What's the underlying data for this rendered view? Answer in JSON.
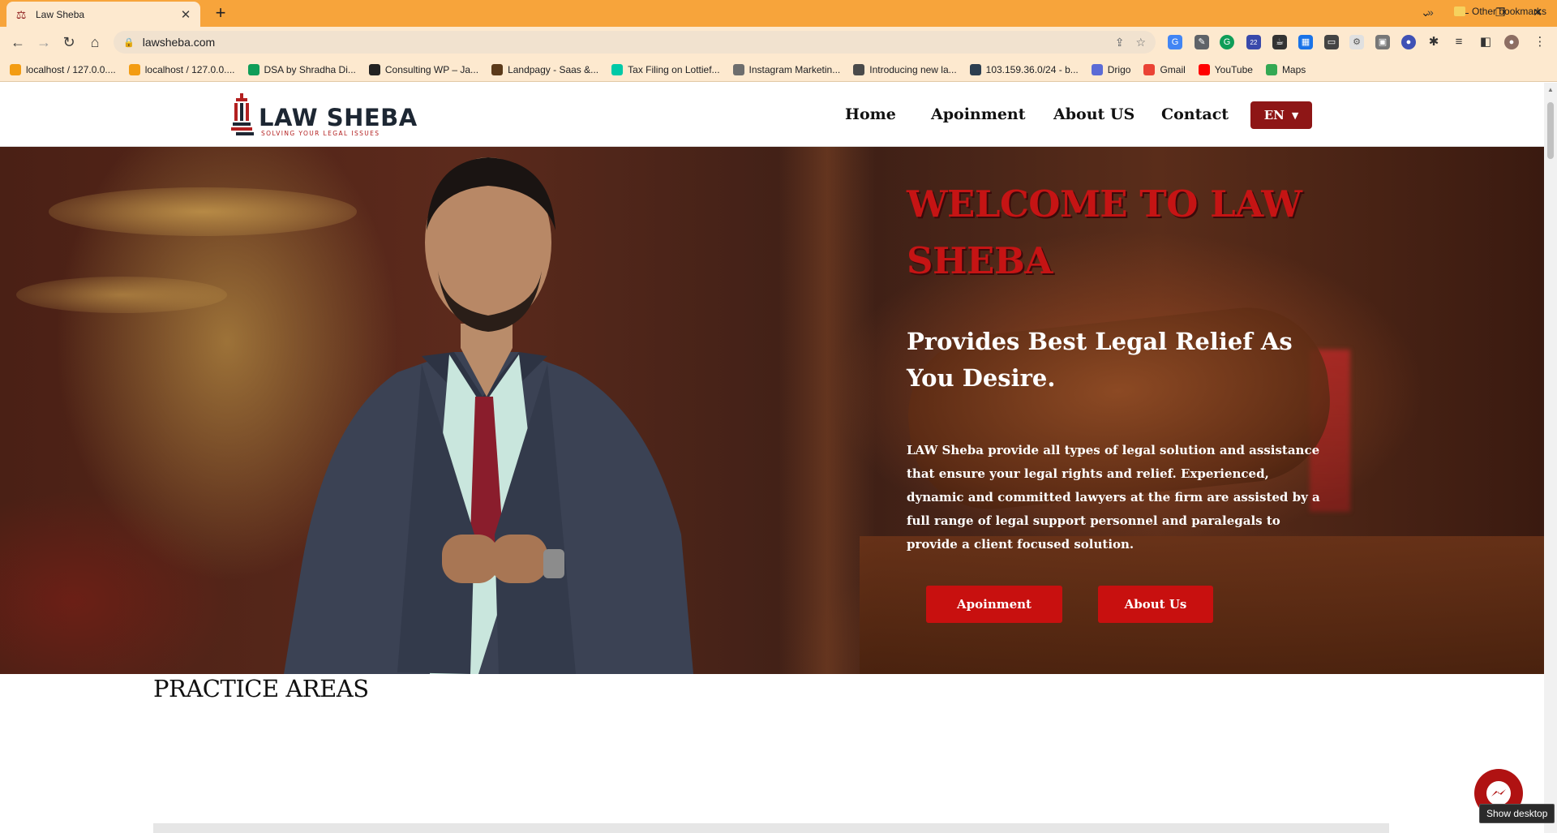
{
  "browser": {
    "tab_title": "Law Sheba",
    "url": "lawsheba.com",
    "bookmarks": [
      {
        "label": "localhost / 127.0.0....",
        "icon": "pma-icon",
        "color": "#f39c12"
      },
      {
        "label": "localhost / 127.0.0....",
        "icon": "pma-icon",
        "color": "#f39c12"
      },
      {
        "label": "DSA by Shradha Di...",
        "icon": "sheets-icon",
        "color": "#0f9d58"
      },
      {
        "label": "Consulting WP – Ja...",
        "icon": "c-icon",
        "color": "#222222"
      },
      {
        "label": "Landpagy - Saas &...",
        "icon": "landpagy-icon",
        "color": "#5b3a1a"
      },
      {
        "label": "Tax Filing on Lottief...",
        "icon": "lottie-icon",
        "color": "#00c9a7"
      },
      {
        "label": "Instagram Marketin...",
        "icon": "instagram-icon",
        "color": "#6d6d6d"
      },
      {
        "label": "Introducing new la...",
        "icon": "wordpress-icon",
        "color": "#4a4a4a"
      },
      {
        "label": "103.159.36.0/24 - b...",
        "icon": "network-icon",
        "color": "#2c3e50"
      },
      {
        "label": "Drigo",
        "icon": "drigo-icon",
        "color": "#5b6bd6"
      },
      {
        "label": "Gmail",
        "icon": "gmail-icon",
        "color": "#ea4335"
      },
      {
        "label": "YouTube",
        "icon": "youtube-icon",
        "color": "#ff0000"
      },
      {
        "label": "Maps",
        "icon": "maps-icon",
        "color": "#34a853"
      }
    ],
    "other_bookmarks": "Other bookmarks",
    "extension_badge": "22"
  },
  "site": {
    "logo_name": "LAW SHEBA",
    "logo_tagline": "SOLVING YOUR LEGAL ISSUES",
    "nav": [
      "Home",
      "Apoinment",
      "About US",
      "Contact"
    ],
    "lang": "EN"
  },
  "hero": {
    "title": "WELCOME TO LAW SHEBA",
    "subtitle": "Provides Best Legal Relief As You Desire.",
    "description": "LAW Sheba provide all types of legal solution and assistance that ensure your legal rights and relief. Experienced, dynamic and committed lawyers at the firm are assisted by a full range of legal support personnel and paralegals to provide a client focused solution.",
    "btn_appointment": "Apoinment",
    "btn_about": "About Us"
  },
  "practice": {
    "heading": "PRACTICE AREAS"
  },
  "tooltip": "Show desktop",
  "colors": {
    "brand_red": "#c8100f",
    "dark_red": "#8e1616",
    "chrome_orange": "#f7a43b"
  }
}
